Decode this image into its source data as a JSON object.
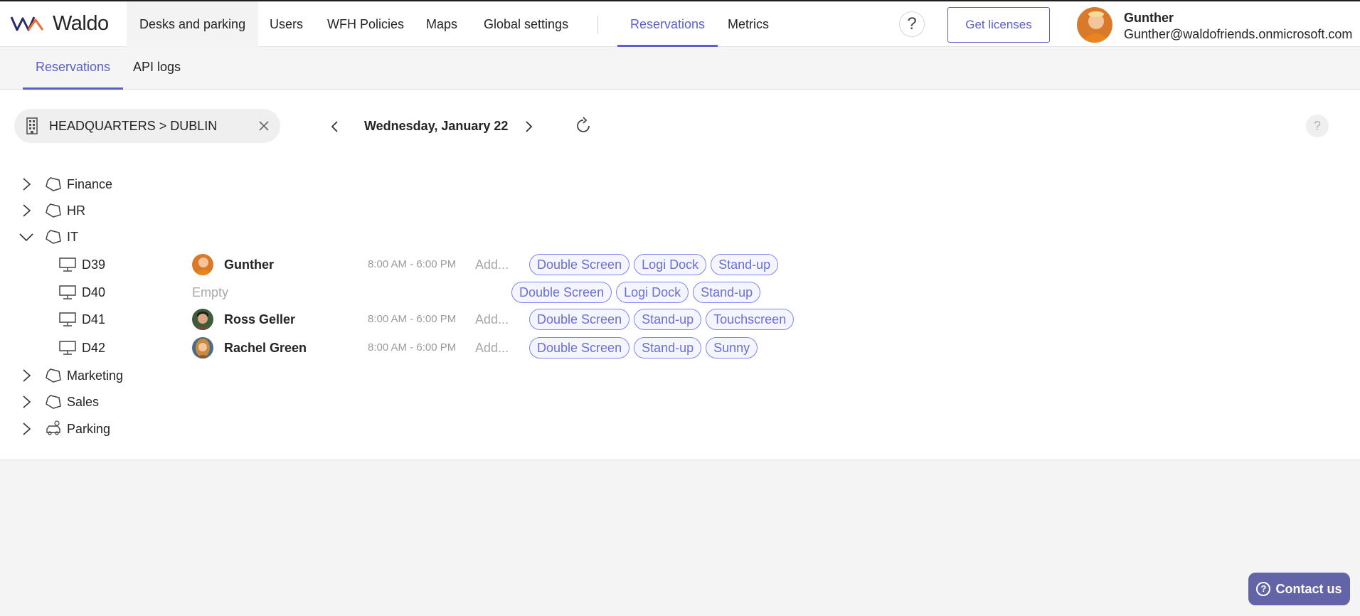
{
  "app": {
    "brand": "Waldo",
    "accent_color": "#5b5fc7"
  },
  "topnav": {
    "items": [
      {
        "label": "Desks and parking"
      },
      {
        "label": "Users"
      },
      {
        "label": "WFH Policies"
      },
      {
        "label": "Maps"
      },
      {
        "label": "Global settings"
      },
      {
        "label": "Reservations"
      },
      {
        "label": "Metrics"
      }
    ],
    "help_label": "?",
    "license_button": "Get licenses",
    "user": {
      "name": "Gunther",
      "email": "Gunther@waldofriends.onmicrosoft.com"
    }
  },
  "subnav": {
    "tabs": [
      {
        "label": "Reservations"
      },
      {
        "label": "API logs"
      }
    ]
  },
  "filter": {
    "location": "HEADQUARTERS > DUBLIN",
    "date": "Wednesday, January 22"
  },
  "help_right": "?",
  "tree": {
    "groups": [
      {
        "label": "Finance",
        "icon": "area-icon"
      },
      {
        "label": "HR",
        "icon": "area-icon"
      },
      {
        "label": "IT",
        "icon": "area-icon"
      },
      {
        "label": "Marketing",
        "icon": "area-icon"
      },
      {
        "label": "Sales",
        "icon": "area-icon"
      },
      {
        "label": "Parking",
        "icon": "parking-icon"
      }
    ],
    "desks": [
      {
        "id": "D39",
        "person": "Gunther",
        "time": "8:00 AM - 6:00 PM",
        "add": "Add...",
        "tags": [
          "Double Screen",
          "Logi Dock",
          "Stand-up"
        ]
      },
      {
        "id": "D40",
        "empty": "Empty",
        "tags": [
          "Double Screen",
          "Logi Dock",
          "Stand-up"
        ]
      },
      {
        "id": "D41",
        "person": "Ross Geller",
        "time": "8:00 AM - 6:00 PM",
        "add": "Add...",
        "tags": [
          "Double Screen",
          "Stand-up",
          "Touchscreen"
        ]
      },
      {
        "id": "D42",
        "person": "Rachel Green",
        "time": "8:00 AM - 6:00 PM",
        "add": "Add...",
        "tags": [
          "Double Screen",
          "Stand-up",
          "Sunny"
        ]
      }
    ]
  },
  "contact": {
    "label": "Contact us"
  }
}
